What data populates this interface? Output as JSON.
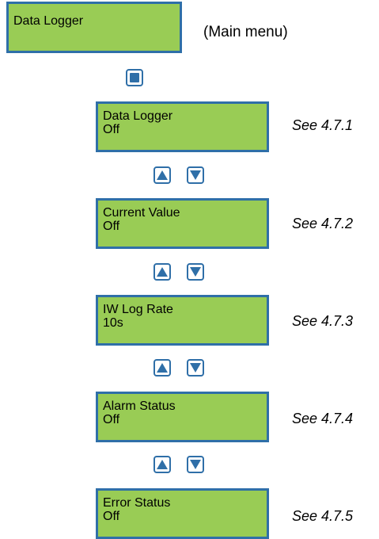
{
  "main_menu": {
    "line1": "Data Logger",
    "note": "(Main menu)"
  },
  "items": [
    {
      "line1": "Data Logger",
      "line2": "Off",
      "ref": "See 4.7.1"
    },
    {
      "line1": "Current Value",
      "line2": "Off",
      "ref": "See 4.7.2"
    },
    {
      "line1": "IW Log Rate",
      "line2": "10s",
      "ref": "See 4.7.3"
    },
    {
      "line1": "Alarm Status",
      "line2": "Off",
      "ref": "See 4.7.4"
    },
    {
      "line1": "Error Status",
      "line2": "Off",
      "ref": "See 4.7.5"
    }
  ],
  "colors": {
    "lcd_background": "#99cc55",
    "lcd_border": "#2f6fa8",
    "button_symbol": "#2f6fa8"
  },
  "icons": {
    "enter": "enter-square-icon",
    "up": "up-arrow-icon",
    "down": "down-arrow-icon"
  }
}
